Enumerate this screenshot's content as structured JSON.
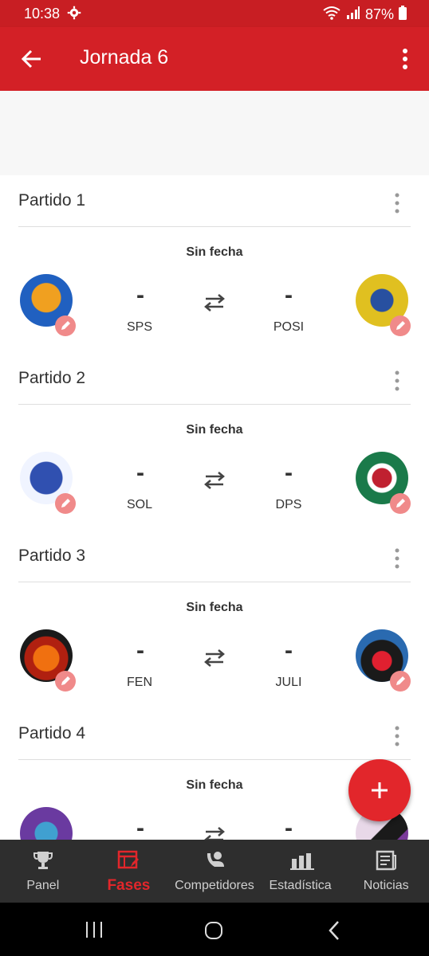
{
  "status": {
    "time": "10:38",
    "battery": "87%"
  },
  "appbar": {
    "title": "Jornada 6"
  },
  "matches": [
    {
      "label": "Partido 1",
      "date": "Sin fecha",
      "home_score": "-",
      "away_score": "-",
      "home_abbr": "SPS",
      "away_abbr": "POSI"
    },
    {
      "label": "Partido 2",
      "date": "Sin fecha",
      "home_score": "-",
      "away_score": "-",
      "home_abbr": "SOL",
      "away_abbr": "DPS"
    },
    {
      "label": "Partido 3",
      "date": "Sin fecha",
      "home_score": "-",
      "away_score": "-",
      "home_abbr": "FEN",
      "away_abbr": "JULI"
    },
    {
      "label": "Partido 4",
      "date": "Sin fecha",
      "home_score": "-",
      "away_score": "-",
      "home_abbr": "",
      "away_abbr": ""
    }
  ],
  "bottom_nav": [
    {
      "label": "Panel",
      "icon": "trophy-icon"
    },
    {
      "label": "Fases",
      "icon": "phases-icon",
      "active": true
    },
    {
      "label": "Competidores",
      "icon": "competitors-icon"
    },
    {
      "label": "Estadística",
      "icon": "stats-icon"
    },
    {
      "label": "Noticias",
      "icon": "news-icon"
    }
  ],
  "colors": {
    "brand": "#d32026",
    "accent": "#e2262b",
    "nav_bg": "#2e2e2e"
  }
}
